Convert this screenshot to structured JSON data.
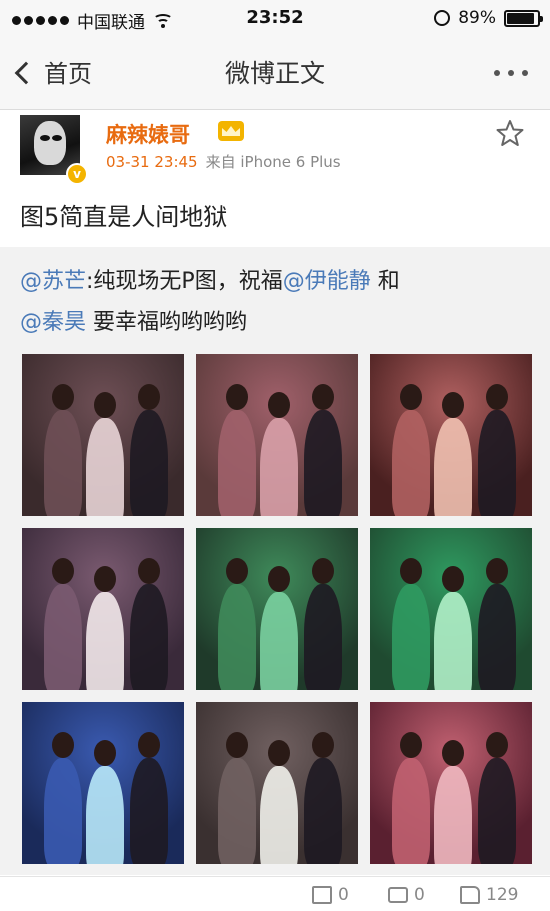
{
  "status_bar": {
    "carrier": "中国联通",
    "time": "23:52",
    "battery": "89%",
    "battery_level": 0.89,
    "signal_dots": 5,
    "signal_filled": 5
  },
  "nav": {
    "back_label": "首页",
    "title": "微博正文"
  },
  "post": {
    "username": "麻辣婊哥",
    "timestamp": "03-31 23:45",
    "source": "来自 iPhone 6 Plus",
    "text": "图5简直是人间地狱",
    "verified_badge": "v"
  },
  "repost": {
    "mention_1": "@苏芒",
    "text_1": ":纯现场无P图，祝福",
    "mention_2": "@伊能静",
    "text_2": " 和",
    "mention_3": "@秦昊",
    "text_3": " 要幸福哟哟哟哟"
  },
  "photos": [
    {
      "bg": "#3a2a2c",
      "tint": "#6e4f55",
      "fig": "#e8d4d6"
    },
    {
      "bg": "#5a3a3a",
      "tint": "#a0606a",
      "fig": "#d8a0a8"
    },
    {
      "bg": "#4a2020",
      "tint": "#b06060",
      "fig": "#f0c0b0"
    },
    {
      "bg": "#3a2a3a",
      "tint": "#7a5a70",
      "fig": "#f2e8ea"
    },
    {
      "bg": "#1f3a2a",
      "tint": "#3f8a5a",
      "fig": "#7ad0a0"
    },
    {
      "bg": "#1f4a30",
      "tint": "#2f9a60",
      "fig": "#b0f0c8"
    },
    {
      "bg": "#1a2a5a",
      "tint": "#3a5ab0",
      "fig": "#b8e8f8"
    },
    {
      "bg": "#3a3030",
      "tint": "#706060",
      "fig": "#f0f0ea"
    },
    {
      "bg": "#5a2030",
      "tint": "#c06070",
      "fig": "#f0b8c0"
    }
  ],
  "actions": {
    "reposts": "0",
    "comments": "0",
    "likes": "129"
  },
  "colors": {
    "username": "#e86b10",
    "mention": "#4a7ab8",
    "badge": "#f4b400"
  }
}
